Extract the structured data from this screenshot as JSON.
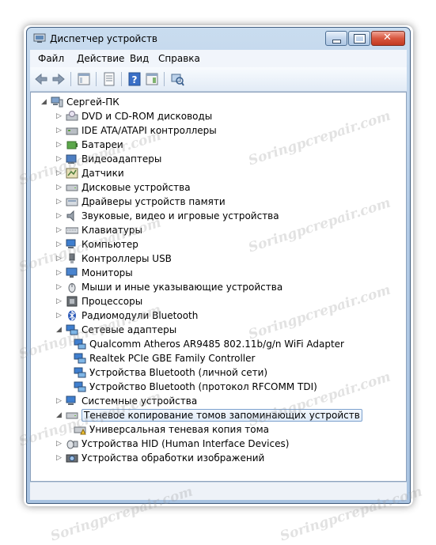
{
  "window": {
    "title": "Диспетчер устройств",
    "controls": [
      "minimize",
      "maximize",
      "close"
    ]
  },
  "menubar": {
    "items": [
      "Файл",
      "Действие",
      "Вид",
      "Справка"
    ]
  },
  "toolbar": {
    "buttons": [
      "back-icon",
      "forward-icon",
      "properties-view-icon",
      "list-view-icon",
      "help-icon",
      "details-icon",
      "scan-hardware-icon"
    ]
  },
  "tree": {
    "root": "Сергей-ПК",
    "categories": [
      {
        "label": "DVD и CD-ROM дисководы",
        "icon": "dvd-drive-icon",
        "expanded": false
      },
      {
        "label": "IDE ATA/ATAPI контроллеры",
        "icon": "ide-controller-icon",
        "expanded": false
      },
      {
        "label": "Батареи",
        "icon": "battery-icon",
        "expanded": false
      },
      {
        "label": "Видеоадаптеры",
        "icon": "display-adapter-icon",
        "expanded": false
      },
      {
        "label": "Датчики",
        "icon": "sensor-icon",
        "expanded": false
      },
      {
        "label": "Дисковые устройства",
        "icon": "disk-drive-icon",
        "expanded": false
      },
      {
        "label": "Драйверы устройств памяти",
        "icon": "storage-driver-icon",
        "expanded": false
      },
      {
        "label": "Звуковые, видео и игровые устройства",
        "icon": "speaker-icon",
        "expanded": false
      },
      {
        "label": "Клавиатуры",
        "icon": "keyboard-icon",
        "expanded": false
      },
      {
        "label": "Компьютер",
        "icon": "computer-icon",
        "expanded": false
      },
      {
        "label": "Контроллеры USB",
        "icon": "usb-icon",
        "expanded": false
      },
      {
        "label": "Мониторы",
        "icon": "monitor-icon",
        "expanded": false
      },
      {
        "label": "Мыши и иные указывающие устройства",
        "icon": "mouse-icon",
        "expanded": false
      },
      {
        "label": "Процессоры",
        "icon": "processor-icon",
        "expanded": false
      },
      {
        "label": "Радиомодули Bluetooth",
        "icon": "bluetooth-icon",
        "expanded": false
      },
      {
        "label": "Сетевые адаптеры",
        "icon": "network-adapter-icon",
        "expanded": true,
        "children": [
          "Qualcomm Atheros AR9485 802.11b/g/n WiFi Adapter",
          "Realtek PCIe GBE Family Controller",
          "Устройства Bluetooth (личной сети)",
          "Устройство Bluetooth (протокол RFCOMM TDI)"
        ]
      },
      {
        "label": "Системные устройства",
        "icon": "system-device-icon",
        "expanded": false
      },
      {
        "label": "Теневое копирование томов запоминающих устройств",
        "icon": "shadow-copy-icon",
        "expanded": true,
        "selected": true,
        "children": [
          "Универсальная теневая копия тома"
        ]
      },
      {
        "label": "Устройства HID (Human Interface Devices)",
        "icon": "hid-icon",
        "expanded": false
      },
      {
        "label": "Устройства обработки изображений",
        "icon": "imaging-device-icon",
        "expanded": false
      }
    ]
  },
  "watermark": "Soringpcrepair.com",
  "colors": {
    "frame": "#b3cbe6",
    "close": "#c94b33",
    "selection": "#e1ecf9"
  }
}
